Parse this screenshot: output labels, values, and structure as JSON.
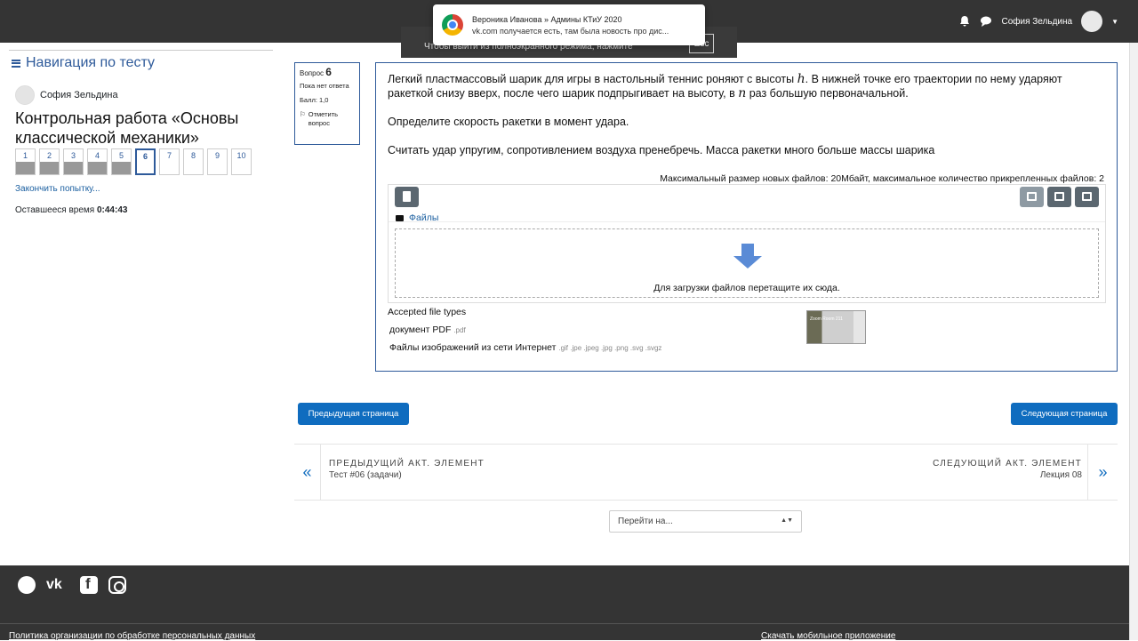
{
  "header": {
    "user_name": "София Зельдина",
    "bell_icon": "bell-icon",
    "chat_icon": "chat-icon"
  },
  "notification": {
    "title": "Вероника Иванова » Админы КТиУ 2020",
    "body": "vk.com  получается есть, там была новость про дис..."
  },
  "toast": {
    "text": "Чтобы выйти из полноэкранного режима, нажмите",
    "key": "Esc"
  },
  "nav": {
    "title": "Навигация по тесту",
    "user_name": "София Зельдина",
    "quiz_name": "Контрольная работа «Основы классической механики»",
    "questions": [
      "1",
      "2",
      "3",
      "4",
      "5",
      "6",
      "7",
      "8",
      "9",
      "10"
    ],
    "finish_link": "Закончить попытку...",
    "timer_label": "Оставшееся время",
    "timer_value": "0:44:43"
  },
  "question_info": {
    "label": "Вопрос",
    "number": "6",
    "status": "Пока нет ответа",
    "grade": "Балл: 1,0",
    "flag": "Отметить вопрос"
  },
  "question": {
    "text1_a": "Легкий пластмассовый шарик для игры в настольный теннис роняют с высоты ",
    "var_h": "h",
    "text1_b": ". В нижней точке его траектории по нему ударяют ракеткой снизу вверх, после чего шарик подпрыгивает на высоту, в ",
    "var_n": "n",
    "text1_c": " раз большую первоначальной.",
    "text2": "Определите скорость ракетки в момент удара.",
    "text3": "Считать удар упругим, сопротивлением воздуха пренебречь. Масса ракетки много больше массы шарика",
    "max_size": "Максимальный размер новых файлов: 20Мбайт, максимальное количество прикрепленных файлов: 2",
    "files_label": "Файлы",
    "drop_text": "Для загрузки файлов перетащите их сюда.",
    "accepted_title": "Accepted file types",
    "types": [
      {
        "name": "документ PDF",
        "ext": ".pdf"
      },
      {
        "name": "Файлы изображений из сети Интернет",
        "ext": ".gif .jpe .jpeg .jpg .png .svg .svgz"
      }
    ],
    "thumb_caption": "Zoom Room 211"
  },
  "buttons": {
    "prev_page": "Предыдущая страница",
    "next_page": "Следующая страница"
  },
  "activity_nav": {
    "prev_label": "ПРЕДЫДУЩИЙ АКТ. ЭЛЕМЕНТ",
    "prev_name": "Тест #06 (задачи)",
    "next_label": "СЛЕДУЮЩИЙ АКТ. ЭЛЕМЕНТ",
    "next_name": "Лекция 08"
  },
  "jump_select": {
    "value": "Перейти на..."
  },
  "footer": {
    "privacy_link": "Политика организации по обработке персональных данных",
    "mobile_link": "Скачать мобильное приложение"
  }
}
